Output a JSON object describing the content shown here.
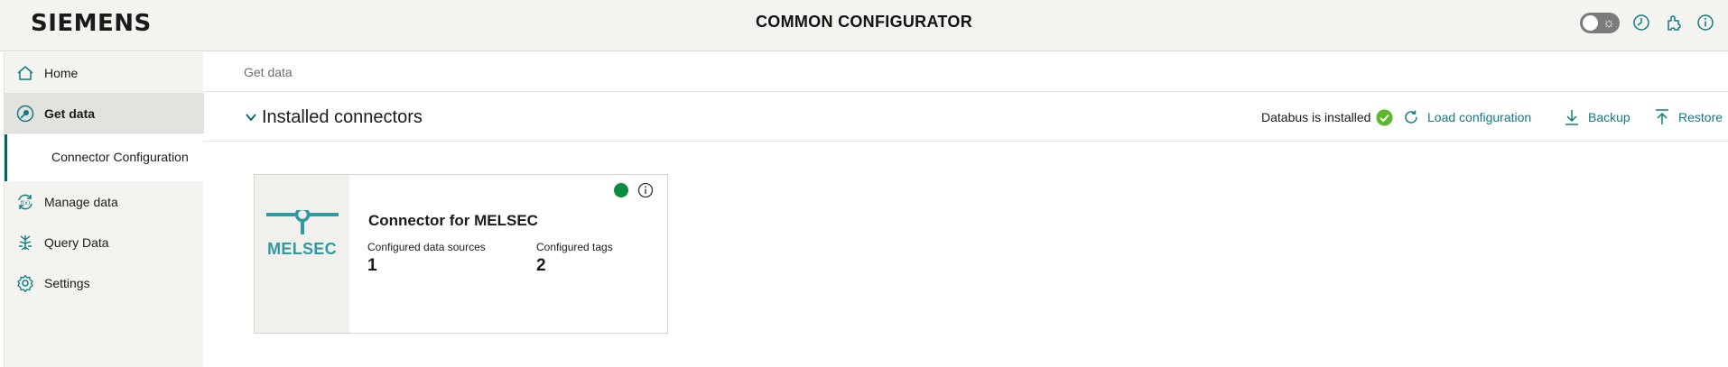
{
  "header": {
    "logo": "SIEMENS",
    "title": "COMMON CONFIGURATOR",
    "icons": [
      "theme-toggle-icon",
      "history-icon",
      "puzzle-icon",
      "info-icon"
    ]
  },
  "sidebar": {
    "items": [
      {
        "label": "Home",
        "icon": "home-icon"
      },
      {
        "label": "Get data",
        "icon": "get-data-icon"
      },
      {
        "label": "Manage data",
        "icon": "manage-data-icon"
      },
      {
        "label": "Query Data",
        "icon": "query-data-icon"
      },
      {
        "label": "Settings",
        "icon": "gear-icon"
      }
    ],
    "subitem": {
      "label": "Connector Configuration"
    }
  },
  "breadcrumb": {
    "label": "Get data"
  },
  "section": {
    "title": "Installed connectors",
    "databus_status": "Databus is installed",
    "actions": {
      "load": "Load configuration",
      "backup": "Backup",
      "restore": "Restore"
    }
  },
  "card": {
    "logo_text": "MELSEC",
    "title": "Connector for MELSEC",
    "sources_label": "Configured data sources",
    "sources_value": "1",
    "tags_label": "Configured tags",
    "tags_value": "2",
    "status": "running"
  },
  "colors": {
    "accent": "#127a84",
    "status_ok": "#0a8c3e",
    "status_check": "#5cb82a",
    "sidebar_bg": "#f3f3f0",
    "melsec": "#2f9aa0"
  }
}
